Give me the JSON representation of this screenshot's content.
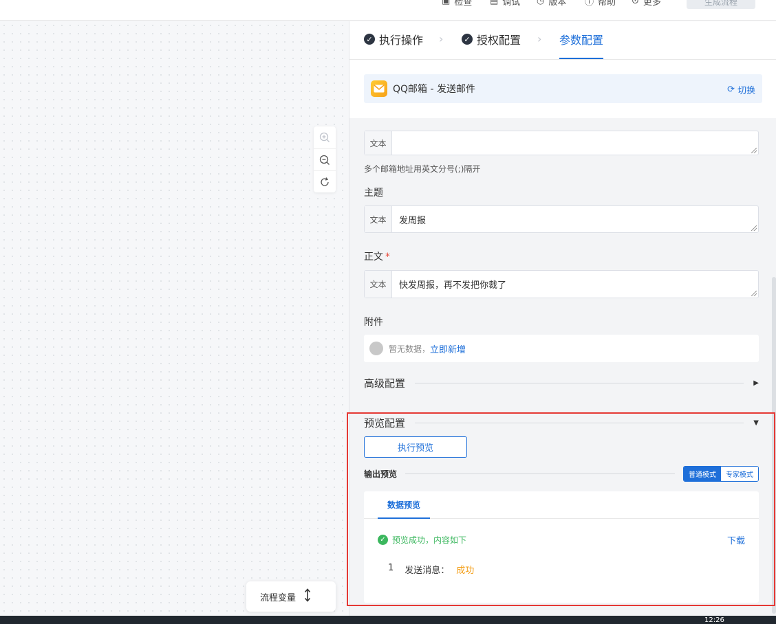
{
  "topbar": {
    "items": [
      "检查",
      "调试",
      "版本",
      "帮助",
      "更多"
    ],
    "publish_label": "生成流程"
  },
  "canvas": {
    "flow_var_label": "流程变量"
  },
  "steps": [
    {
      "label": "执行操作",
      "done": true
    },
    {
      "label": "授权配置",
      "done": true
    },
    {
      "label": "参数配置",
      "active": true
    }
  ],
  "app": {
    "name": "QQ邮箱 - 发送邮件",
    "switch_label": "切换"
  },
  "form": {
    "text_tag": "文本",
    "recipient_hint": "多个邮箱地址用英文分号(;)隔开",
    "subject_label": "主题",
    "subject_value": "发周报",
    "body_label": "正文",
    "body_required": "*",
    "body_value": "快发周报，再不发把你裁了",
    "attachment_label": "附件",
    "attachment_empty": "暂无数据，",
    "attachment_add": "立即新增"
  },
  "advanced": {
    "label": "高级配置"
  },
  "preview": {
    "label": "预览配置",
    "run_button": "执行预览",
    "output_label": "输出预览",
    "mode_normal": "普通模式",
    "mode_expert": "专家模式",
    "tab_label": "数据预览",
    "status_text": "预览成功，内容如下",
    "download_label": "下载",
    "row_index": "1",
    "row_key": "发送消息：",
    "row_value": "成功"
  },
  "taskbar": {
    "time": "12:26"
  },
  "colors": {
    "accent": "#1e6fd9",
    "success": "#3bb75e",
    "warning": "#f39c12",
    "highlight": "#e53935"
  }
}
